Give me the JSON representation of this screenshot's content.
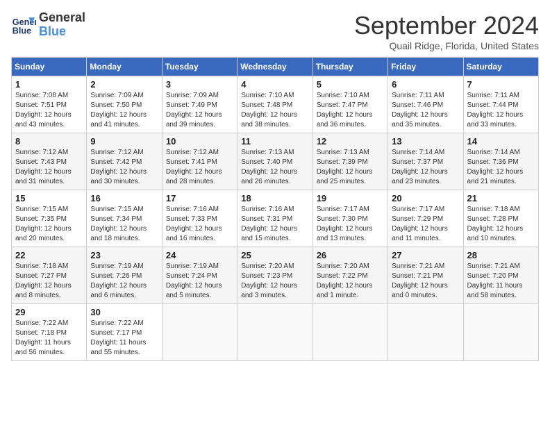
{
  "logo": {
    "line1": "General",
    "line2": "Blue"
  },
  "title": "September 2024",
  "subtitle": "Quail Ridge, Florida, United States",
  "days_of_week": [
    "Sunday",
    "Monday",
    "Tuesday",
    "Wednesday",
    "Thursday",
    "Friday",
    "Saturday"
  ],
  "weeks": [
    [
      {
        "day": "1",
        "info": "Sunrise: 7:08 AM\nSunset: 7:51 PM\nDaylight: 12 hours\nand 43 minutes."
      },
      {
        "day": "2",
        "info": "Sunrise: 7:09 AM\nSunset: 7:50 PM\nDaylight: 12 hours\nand 41 minutes."
      },
      {
        "day": "3",
        "info": "Sunrise: 7:09 AM\nSunset: 7:49 PM\nDaylight: 12 hours\nand 39 minutes."
      },
      {
        "day": "4",
        "info": "Sunrise: 7:10 AM\nSunset: 7:48 PM\nDaylight: 12 hours\nand 38 minutes."
      },
      {
        "day": "5",
        "info": "Sunrise: 7:10 AM\nSunset: 7:47 PM\nDaylight: 12 hours\nand 36 minutes."
      },
      {
        "day": "6",
        "info": "Sunrise: 7:11 AM\nSunset: 7:46 PM\nDaylight: 12 hours\nand 35 minutes."
      },
      {
        "day": "7",
        "info": "Sunrise: 7:11 AM\nSunset: 7:44 PM\nDaylight: 12 hours\nand 33 minutes."
      }
    ],
    [
      {
        "day": "8",
        "info": "Sunrise: 7:12 AM\nSunset: 7:43 PM\nDaylight: 12 hours\nand 31 minutes."
      },
      {
        "day": "9",
        "info": "Sunrise: 7:12 AM\nSunset: 7:42 PM\nDaylight: 12 hours\nand 30 minutes."
      },
      {
        "day": "10",
        "info": "Sunrise: 7:12 AM\nSunset: 7:41 PM\nDaylight: 12 hours\nand 28 minutes."
      },
      {
        "day": "11",
        "info": "Sunrise: 7:13 AM\nSunset: 7:40 PM\nDaylight: 12 hours\nand 26 minutes."
      },
      {
        "day": "12",
        "info": "Sunrise: 7:13 AM\nSunset: 7:39 PM\nDaylight: 12 hours\nand 25 minutes."
      },
      {
        "day": "13",
        "info": "Sunrise: 7:14 AM\nSunset: 7:37 PM\nDaylight: 12 hours\nand 23 minutes."
      },
      {
        "day": "14",
        "info": "Sunrise: 7:14 AM\nSunset: 7:36 PM\nDaylight: 12 hours\nand 21 minutes."
      }
    ],
    [
      {
        "day": "15",
        "info": "Sunrise: 7:15 AM\nSunset: 7:35 PM\nDaylight: 12 hours\nand 20 minutes."
      },
      {
        "day": "16",
        "info": "Sunrise: 7:15 AM\nSunset: 7:34 PM\nDaylight: 12 hours\nand 18 minutes."
      },
      {
        "day": "17",
        "info": "Sunrise: 7:16 AM\nSunset: 7:33 PM\nDaylight: 12 hours\nand 16 minutes."
      },
      {
        "day": "18",
        "info": "Sunrise: 7:16 AM\nSunset: 7:31 PM\nDaylight: 12 hours\nand 15 minutes."
      },
      {
        "day": "19",
        "info": "Sunrise: 7:17 AM\nSunset: 7:30 PM\nDaylight: 12 hours\nand 13 minutes."
      },
      {
        "day": "20",
        "info": "Sunrise: 7:17 AM\nSunset: 7:29 PM\nDaylight: 12 hours\nand 11 minutes."
      },
      {
        "day": "21",
        "info": "Sunrise: 7:18 AM\nSunset: 7:28 PM\nDaylight: 12 hours\nand 10 minutes."
      }
    ],
    [
      {
        "day": "22",
        "info": "Sunrise: 7:18 AM\nSunset: 7:27 PM\nDaylight: 12 hours\nand 8 minutes."
      },
      {
        "day": "23",
        "info": "Sunrise: 7:19 AM\nSunset: 7:26 PM\nDaylight: 12 hours\nand 6 minutes."
      },
      {
        "day": "24",
        "info": "Sunrise: 7:19 AM\nSunset: 7:24 PM\nDaylight: 12 hours\nand 5 minutes."
      },
      {
        "day": "25",
        "info": "Sunrise: 7:20 AM\nSunset: 7:23 PM\nDaylight: 12 hours\nand 3 minutes."
      },
      {
        "day": "26",
        "info": "Sunrise: 7:20 AM\nSunset: 7:22 PM\nDaylight: 12 hours\nand 1 minute."
      },
      {
        "day": "27",
        "info": "Sunrise: 7:21 AM\nSunset: 7:21 PM\nDaylight: 12 hours\nand 0 minutes."
      },
      {
        "day": "28",
        "info": "Sunrise: 7:21 AM\nSunset: 7:20 PM\nDaylight: 11 hours\nand 58 minutes."
      }
    ],
    [
      {
        "day": "29",
        "info": "Sunrise: 7:22 AM\nSunset: 7:18 PM\nDaylight: 11 hours\nand 56 minutes."
      },
      {
        "day": "30",
        "info": "Sunrise: 7:22 AM\nSunset: 7:17 PM\nDaylight: 11 hours\nand 55 minutes."
      },
      {
        "day": "",
        "info": ""
      },
      {
        "day": "",
        "info": ""
      },
      {
        "day": "",
        "info": ""
      },
      {
        "day": "",
        "info": ""
      },
      {
        "day": "",
        "info": ""
      }
    ]
  ]
}
